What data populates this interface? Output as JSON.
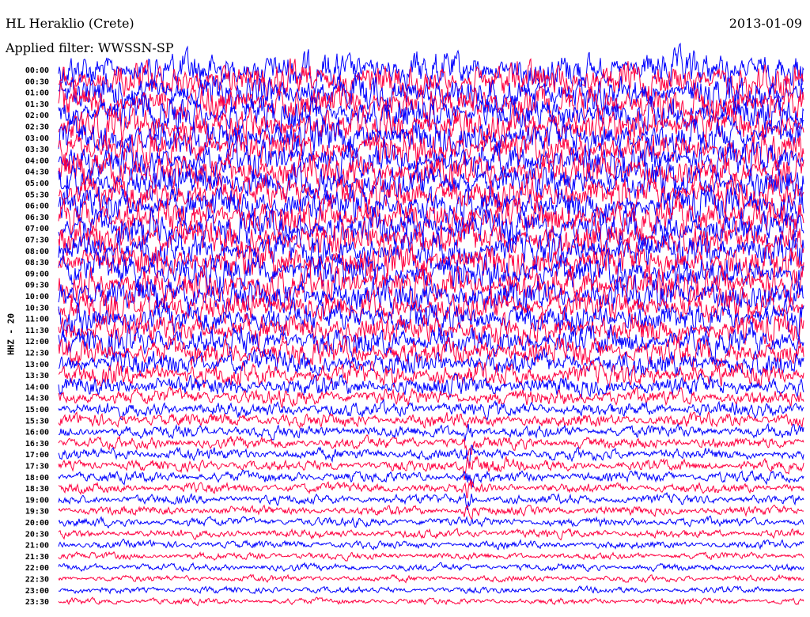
{
  "header": {
    "station": "HL Heraklio (Crete)",
    "date": "2013-01-09",
    "filter": "Applied filter: WWSSN-SP"
  },
  "chart_data": {
    "type": "line",
    "title": "HL Heraklio (Crete)",
    "subtitle": "Applied filter: WWSSN-SP",
    "ylabel": "HHZ - 20",
    "row_minutes": 30,
    "row_labels": [
      "00:00",
      "00:30",
      "01:00",
      "01:30",
      "02:00",
      "02:30",
      "03:00",
      "03:30",
      "04:00",
      "04:30",
      "05:00",
      "05:30",
      "06:00",
      "06:30",
      "07:00",
      "07:30",
      "08:00",
      "08:30",
      "09:00",
      "09:30",
      "10:00",
      "10:30",
      "11:00",
      "11:30",
      "12:00",
      "12:30",
      "13:00",
      "13:30",
      "14:00",
      "14:30",
      "15:00",
      "15:30",
      "16:00",
      "16:30",
      "17:00",
      "17:30",
      "18:00",
      "18:30",
      "19:00",
      "19:30",
      "20:00",
      "20:30",
      "21:00",
      "21:30",
      "22:00",
      "22:30",
      "23:00",
      "23:30"
    ],
    "series_colors": [
      "#0000ff",
      "#ff0040"
    ],
    "relative_noise_level": [
      1,
      1,
      1,
      1,
      1,
      1,
      1,
      1,
      1,
      1,
      1,
      1,
      1,
      1,
      1,
      1,
      1,
      1,
      1,
      1,
      0.95,
      0.9,
      0.9,
      0.85,
      0.8,
      0.75,
      0.7,
      0.65,
      0.55,
      0.45,
      0.4,
      0.38,
      0.35,
      0.33,
      0.32,
      0.3,
      0.3,
      0.28,
      0.27,
      0.26,
      0.25,
      0.24,
      0.22,
      0.2,
      0.2,
      0.18,
      0.18,
      0.17
    ],
    "event": {
      "row": "17:30",
      "minute_in_row": 16.5,
      "relative_amplitude": 3
    }
  }
}
